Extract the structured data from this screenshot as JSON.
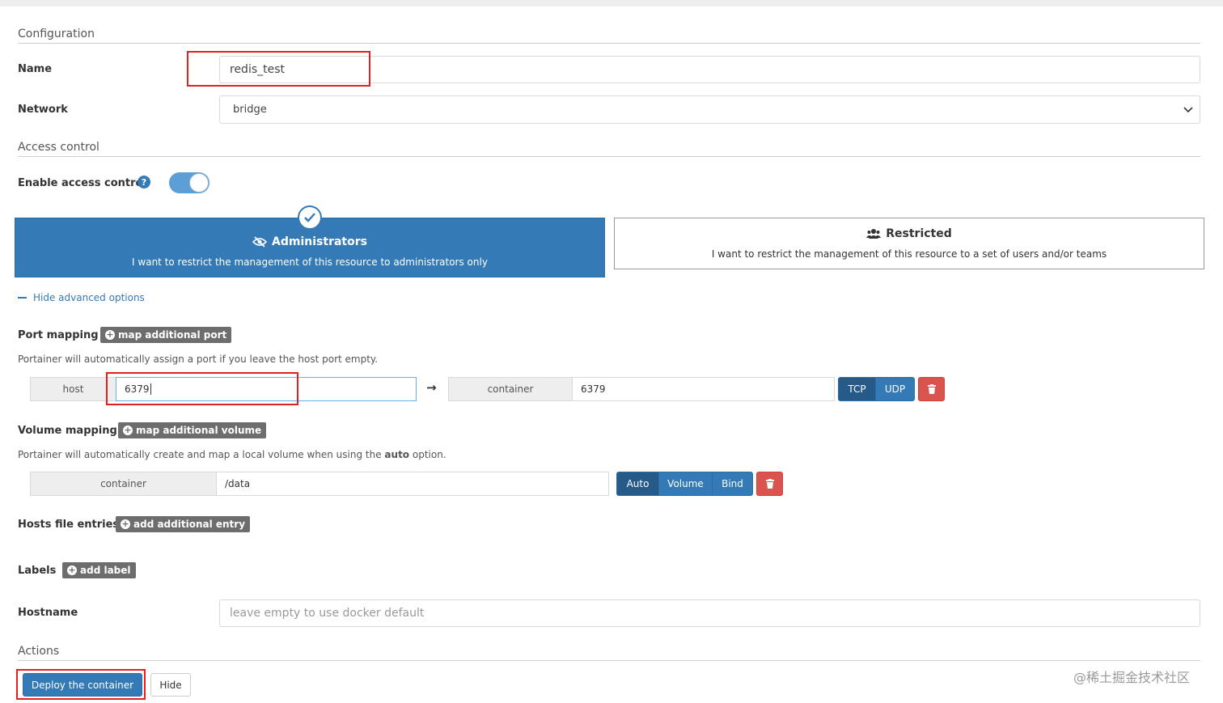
{
  "configuration": {
    "title": "Configuration",
    "name_label": "Name",
    "name_value": "redis_test",
    "network_label": "Network",
    "network_value": "bridge"
  },
  "access_control": {
    "title": "Access control",
    "enable_label": "Enable access control",
    "help_icon": "?",
    "enabled": true,
    "administrators": {
      "title": "Administrators",
      "description": "I want to restrict the management of this resource to administrators only",
      "selected": true
    },
    "restricted": {
      "title": "Restricted",
      "description": "I want to restrict the management of this resource to a set of users and/or teams"
    }
  },
  "advanced": {
    "toggle_label": "Hide advanced options"
  },
  "port_mapping": {
    "label": "Port mapping",
    "add_button": "map additional port",
    "hint": "Portainer will automatically assign a port if you leave the host port empty.",
    "host_label": "host",
    "host_value": "6379",
    "arrow": "→",
    "container_label": "container",
    "container_value": "6379",
    "protocols": [
      "TCP",
      "UDP"
    ],
    "active_protocol": "TCP"
  },
  "volume_mapping": {
    "label": "Volume mapping",
    "add_button": "map additional volume",
    "hint_prefix": "Portainer will automatically create and map a local volume when using the ",
    "hint_bold": "auto",
    "hint_suffix": " option.",
    "container_label": "container",
    "container_value": "/data",
    "modes": [
      "Auto",
      "Volume",
      "Bind"
    ],
    "active_mode": "Auto"
  },
  "hosts_file": {
    "label": "Hosts file entries",
    "add_button": "add additional entry"
  },
  "labels": {
    "label": "Labels",
    "add_button": "add label"
  },
  "hostname": {
    "label": "Hostname",
    "placeholder": "leave empty to use docker default"
  },
  "actions": {
    "title": "Actions",
    "deploy_button": "Deploy the container",
    "hide_button": "Hide"
  },
  "watermark": "@稀土掘金技术社区",
  "colors": {
    "primary": "#337ab7",
    "primary_active": "#265a88",
    "danger": "#d9534f",
    "highlight_box": "#e02020",
    "gray_button": "#6d6d6d"
  }
}
